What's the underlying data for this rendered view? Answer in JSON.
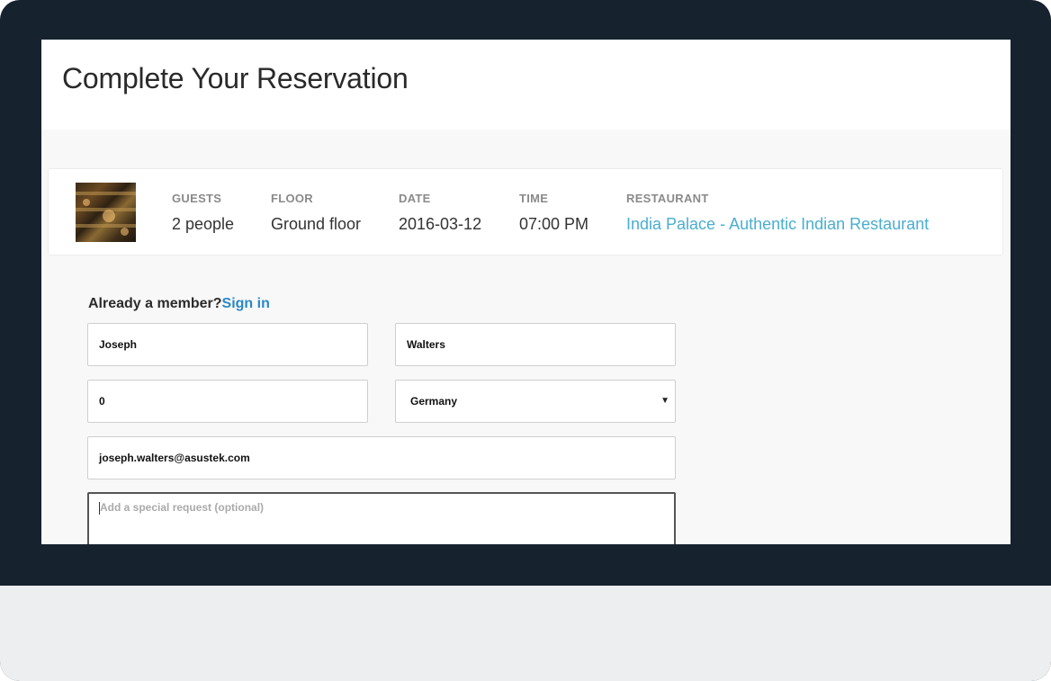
{
  "page": {
    "title": "Complete Your Reservation"
  },
  "summary": {
    "thumbnail_alt": "restaurant-interior-photo",
    "guests": {
      "label": "GUESTS",
      "value": "2 people"
    },
    "floor": {
      "label": "FLOOR",
      "value": "Ground floor"
    },
    "date": {
      "label": "DATE",
      "value": "2016-03-12"
    },
    "time": {
      "label": "TIME",
      "value": "07:00 PM"
    },
    "restaurant": {
      "label": "RESTAURANT",
      "value": "India Palace - Authentic Indian Restaurant"
    }
  },
  "form": {
    "member_prompt": "Already a member?",
    "sign_in_label": "Sign in",
    "first_name": "Joseph",
    "last_name": "Walters",
    "phone": "0",
    "country": "Germany",
    "email": "joseph.walters@asustek.com",
    "special_request_placeholder": "Add a special request (optional)"
  },
  "icons": {
    "select_arrow": "caret-down-icon"
  },
  "colors": {
    "device_frame": "#16222d",
    "link": "#4aaed1",
    "sign_in": "#2a88c8",
    "page_background": "#f8f8f8"
  }
}
